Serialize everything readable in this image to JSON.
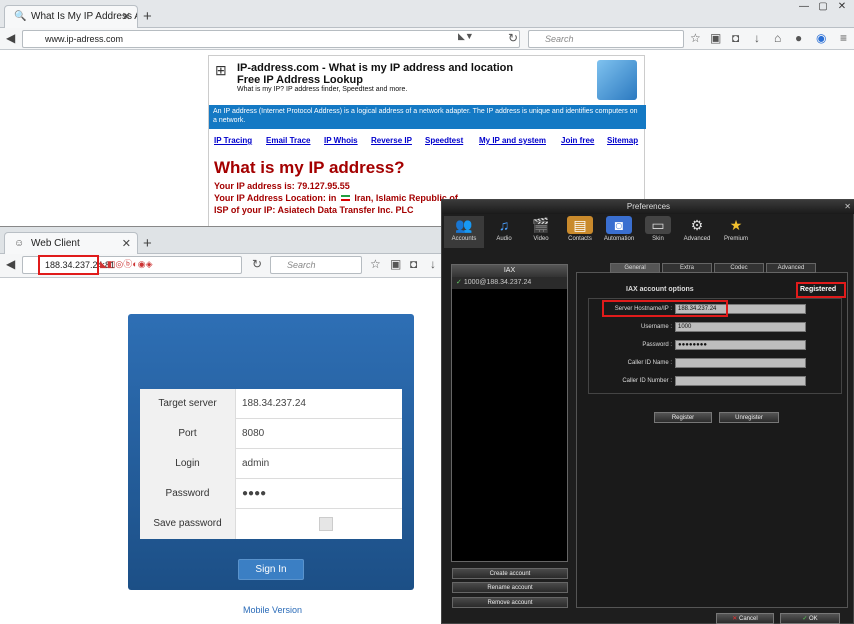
{
  "back_browser": {
    "tab_title": "What Is My IP Address At I...",
    "url": "www.ip-adress.com",
    "search_placeholder": "Search"
  },
  "ip_page": {
    "title_line1": "IP-address.com - What is my IP address and location",
    "title_line2": "Free IP Address Lookup",
    "subtitle": "What is my IP? IP address finder, Speedtest and more.",
    "blue_text": "An IP address (Internet Protocol Address) is a logical address of a network adapter. The IP address is unique and identifies computers on a network.",
    "nav_links": [
      "IP Tracing",
      "Email Trace",
      "IP Whois",
      "Reverse IP",
      "Speedtest",
      "My IP and system",
      "Join free",
      "Sitemap"
    ],
    "heading": "What is my IP address?",
    "ip_line": "Your IP address is: 79.127.95.55",
    "location_line": "Your IP Address Location: in",
    "location_value": "Iran, Islamic Republic of",
    "isp_line": "ISP of your IP: Asiatech Data Transfer Inc. PLC"
  },
  "front_browser": {
    "tab_title": "Web Client",
    "url": "188.34.237.24:81",
    "search_placeholder": "Search"
  },
  "login": {
    "rows": [
      {
        "label": "Target server",
        "value": "188.34.237.24"
      },
      {
        "label": "Port",
        "value": "8080"
      },
      {
        "label": "Login",
        "value": "admin"
      },
      {
        "label": "Password",
        "value": "●●●●"
      },
      {
        "label": "Save password",
        "value": ""
      }
    ],
    "signin_label": "Sign In",
    "mobile_link": "Mobile Version"
  },
  "prefs": {
    "title": "Preferences",
    "tabs": [
      "Accounts",
      "Audio",
      "Video",
      "Contacts",
      "Automation",
      "Skin",
      "Advanced",
      "Premium"
    ],
    "list_header": "IAX",
    "account_item": "1000@188.34.237.24",
    "side_buttons": [
      "Create account",
      "Rename account",
      "Remove account"
    ],
    "sub_tabs": [
      "General",
      "Extra",
      "Codec",
      "Advanced"
    ],
    "section_title": "IAX account options",
    "status": "Registered",
    "fields": [
      {
        "label": "Server Hostname/IP :",
        "value": "188.34.237.24"
      },
      {
        "label": "Username :",
        "value": "1000"
      },
      {
        "label": "Password :",
        "value": "●●●●●●●●"
      },
      {
        "label": "Caller ID Name :",
        "value": ""
      },
      {
        "label": "Caller ID Number :",
        "value": ""
      }
    ],
    "register_label": "Register",
    "unregister_label": "Unregister",
    "cancel_label": "Cancel",
    "ok_label": "OK"
  }
}
